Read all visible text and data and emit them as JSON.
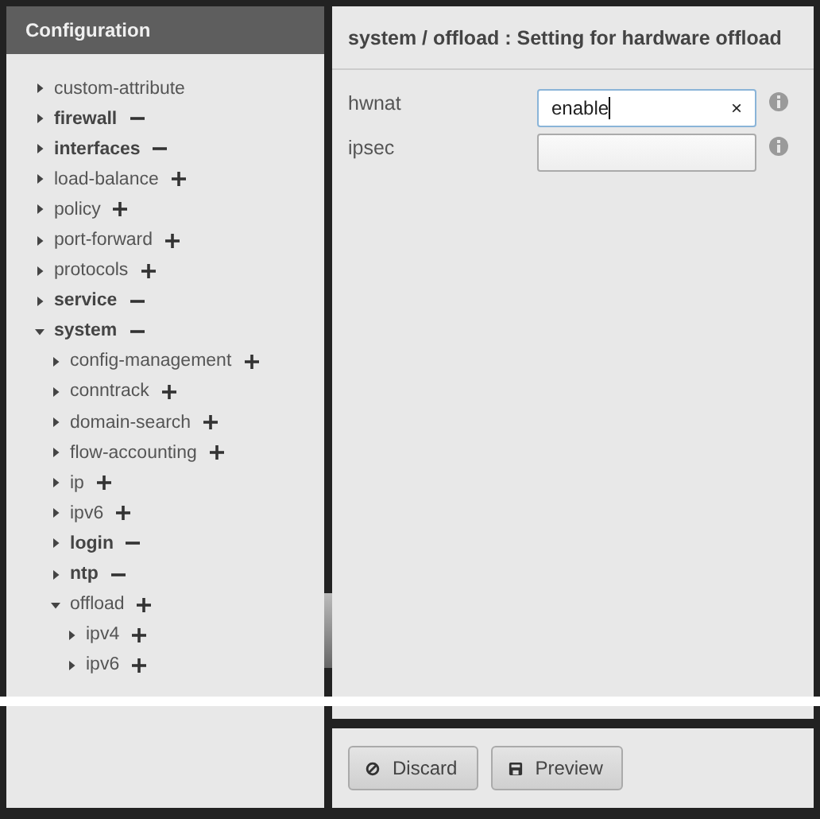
{
  "sidebar": {
    "title": "Configuration",
    "tree": [
      {
        "label": "custom-attribute",
        "bold": false,
        "expanded": false
      },
      {
        "label": "firewall",
        "bold": true,
        "expanded": false,
        "kind": "minus"
      },
      {
        "label": "interfaces",
        "bold": true,
        "expanded": false,
        "kind": "minus"
      },
      {
        "label": "load-balance",
        "bold": false,
        "expanded": false,
        "kind": "plus"
      },
      {
        "label": "policy",
        "bold": false,
        "expanded": false,
        "kind": "plus"
      },
      {
        "label": "port-forward",
        "bold": false,
        "expanded": false,
        "kind": "plus"
      },
      {
        "label": "protocols",
        "bold": false,
        "expanded": false,
        "kind": "plus"
      },
      {
        "label": "service",
        "bold": true,
        "expanded": false,
        "kind": "minus"
      },
      {
        "label": "system",
        "bold": true,
        "expanded": true,
        "kind": "minus",
        "children": [
          {
            "label": "config-management",
            "bold": false,
            "expanded": false,
            "kind": "plus"
          },
          {
            "label": "conntrack",
            "bold": false,
            "expanded": false,
            "kind": "plus"
          },
          {
            "label": "domain-search",
            "bold": false,
            "expanded": false,
            "kind": "plus"
          },
          {
            "label": "flow-accounting",
            "bold": false,
            "expanded": false,
            "kind": "plus"
          },
          {
            "label": "ip",
            "bold": false,
            "expanded": false,
            "kind": "plus"
          },
          {
            "label": "ipv6",
            "bold": false,
            "expanded": false,
            "kind": "plus"
          },
          {
            "label": "login",
            "bold": true,
            "expanded": false,
            "kind": "minus"
          },
          {
            "label": "ntp",
            "bold": true,
            "expanded": false,
            "kind": "minus"
          },
          {
            "label": "offload",
            "bold": false,
            "expanded": true,
            "kind": "plus",
            "children": [
              {
                "label": "ipv4",
                "bold": false,
                "expanded": false,
                "kind": "plus"
              },
              {
                "label": "ipv6",
                "bold": false,
                "expanded": false,
                "kind": "plus"
              }
            ]
          }
        ]
      }
    ]
  },
  "panel": {
    "title": "system / offload : Setting for hardware offload",
    "fields": [
      {
        "label": "hwnat",
        "value": "enable",
        "focused": true,
        "clear": "×"
      },
      {
        "label": "ipsec",
        "focused": false
      }
    ]
  },
  "buttons": [
    {
      "label": "Discard",
      "kind": "ban"
    },
    {
      "label": "Preview",
      "kind": "save"
    }
  ]
}
